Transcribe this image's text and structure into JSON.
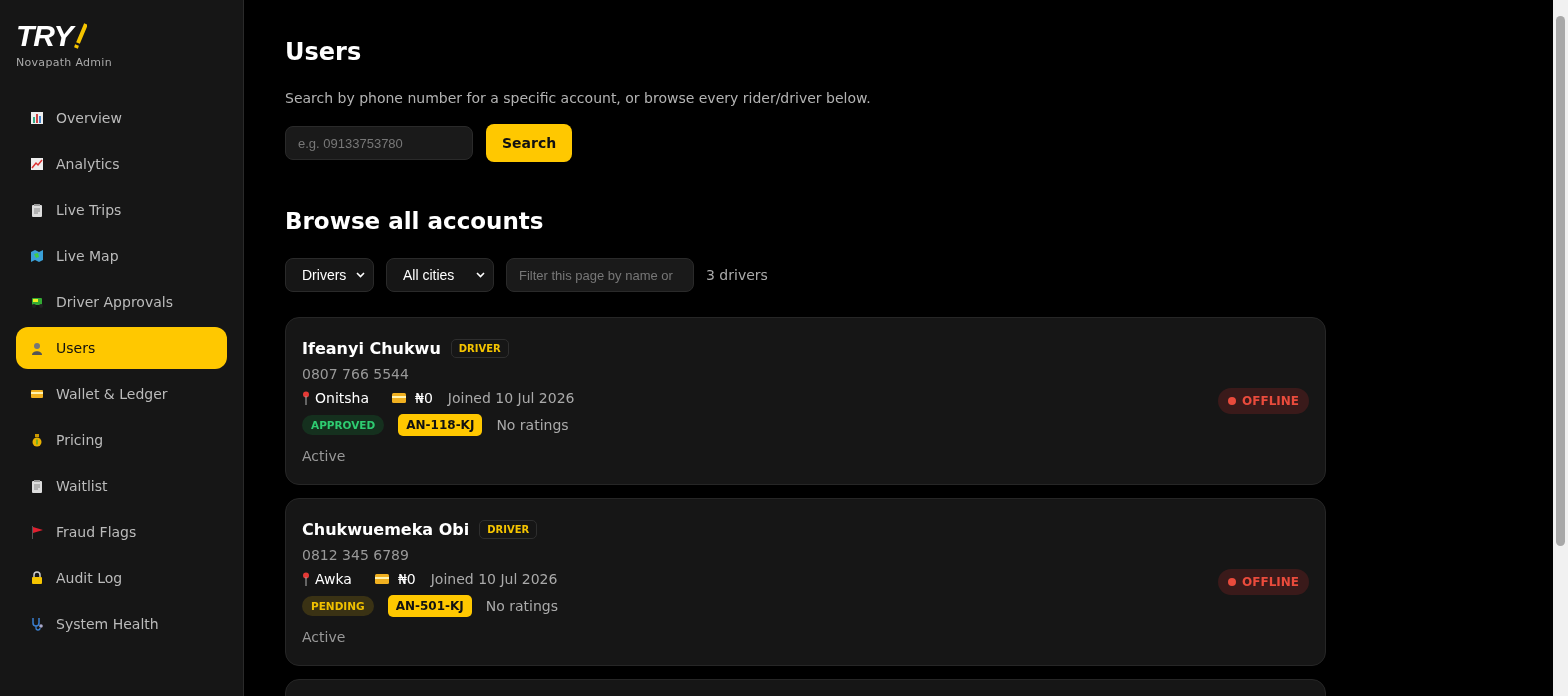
{
  "brand": {
    "logo": "TRY",
    "subtitle": "Novapath Admin"
  },
  "sidebar": {
    "items": [
      {
        "label": "Overview",
        "selected": false
      },
      {
        "label": "Analytics",
        "selected": false
      },
      {
        "label": "Live Trips",
        "selected": false
      },
      {
        "label": "Live Map",
        "selected": false
      },
      {
        "label": "Driver Approvals",
        "selected": false
      },
      {
        "label": "Users",
        "selected": true
      },
      {
        "label": "Wallet & Ledger",
        "selected": false
      },
      {
        "label": "Pricing",
        "selected": false
      },
      {
        "label": "Waitlist",
        "selected": false
      },
      {
        "label": "Fraud Flags",
        "selected": false
      },
      {
        "label": "Audit Log",
        "selected": false
      },
      {
        "label": "System Health",
        "selected": false
      }
    ]
  },
  "page": {
    "title": "Users",
    "description": "Search by phone number for a specific account, or browse every rider/driver below.",
    "search": {
      "placeholder": "e.g. 09133753780",
      "button": "Search"
    }
  },
  "browse": {
    "title": "Browse all accounts",
    "role_filter": "Drivers",
    "city_filter": "All cities",
    "filter": {
      "placeholder": "Filter this page by name or"
    },
    "count": "3 drivers"
  },
  "accounts": [
    {
      "name": "Ifeanyi Chukwu",
      "role": "DRIVER",
      "phone": "0807 766 5544",
      "city": "Onitsha",
      "balance": "₦0",
      "joined": "Joined 10 Jul 2026",
      "approval": {
        "label": "APPROVED",
        "kind": "approved"
      },
      "plate": "AN-118-KJ",
      "rating": "No ratings",
      "account_state": "Active",
      "status": {
        "label": "OFFLINE",
        "kind": "offline"
      }
    },
    {
      "name": "Chukwuemeka Obi",
      "role": "DRIVER",
      "phone": "0812 345 6789",
      "city": "Awka",
      "balance": "₦0",
      "joined": "Joined 10 Jul 2026",
      "approval": {
        "label": "PENDING",
        "kind": "pending"
      },
      "plate": "AN-501-KJ",
      "rating": "No ratings",
      "account_state": "Active",
      "status": {
        "label": "OFFLINE",
        "kind": "offline"
      }
    }
  ]
}
